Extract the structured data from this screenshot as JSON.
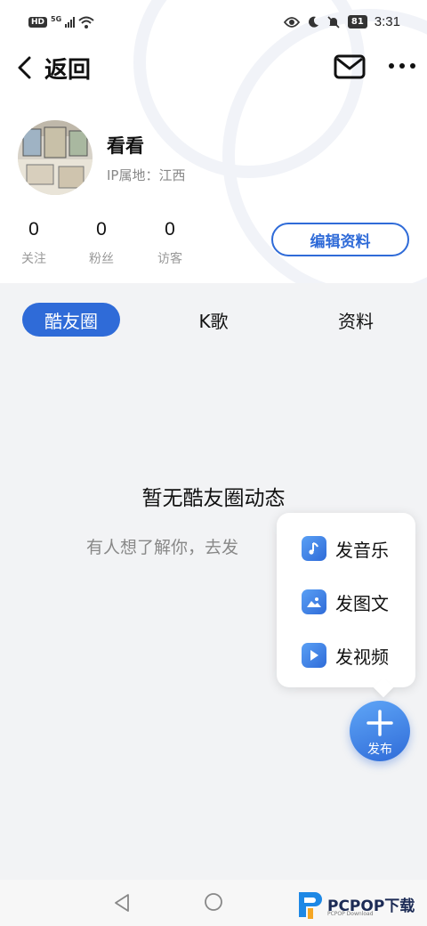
{
  "status_bar": {
    "network_badge": "HD",
    "signal_type": "5G",
    "battery": "81",
    "time": "3:31"
  },
  "nav": {
    "back_label": "返回",
    "icons": [
      "back-arrow-icon",
      "mail-icon",
      "more-icon"
    ]
  },
  "profile": {
    "nickname": "看看",
    "ip_location": "IP属地：江西",
    "stats": [
      {
        "value": "0",
        "label": "关注"
      },
      {
        "value": "0",
        "label": "粉丝"
      },
      {
        "value": "0",
        "label": "访客"
      }
    ],
    "edit_button": "编辑资料"
  },
  "tabs": [
    {
      "label": "酷友圈",
      "active": true
    },
    {
      "label": "K歌",
      "active": false
    },
    {
      "label": "资料",
      "active": false
    }
  ],
  "empty_state": {
    "title": "暂无酷友圈动态",
    "subtitle": "有人想了解你，去发"
  },
  "publish_menu": {
    "items": [
      {
        "label": "发音乐",
        "icon": "music-note-icon"
      },
      {
        "label": "发图文",
        "icon": "image-icon"
      },
      {
        "label": "发视频",
        "icon": "play-icon"
      }
    ]
  },
  "fab": {
    "label": "发布",
    "icon": "plus-icon"
  },
  "colors": {
    "accent": "#2f6bd8",
    "page_bg": "#f2f3f5"
  },
  "watermark": {
    "brand": "PCPOP下载",
    "small": "PCPOP Download"
  }
}
